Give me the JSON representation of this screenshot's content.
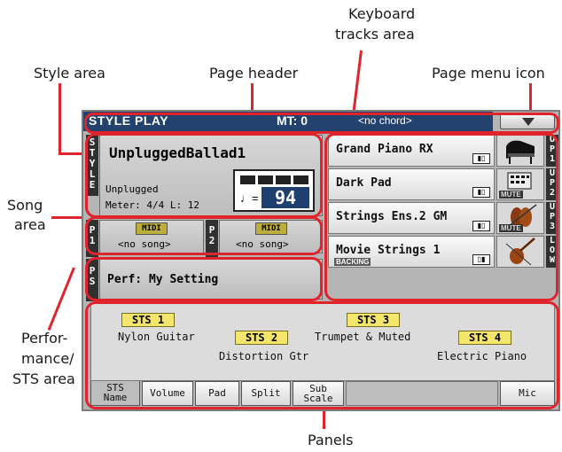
{
  "callouts": {
    "keyboard_tracks_line1": "Keyboard",
    "keyboard_tracks_line2": "tracks area",
    "style_area": "Style area",
    "page_header": "Page header",
    "page_menu_icon": "Page menu icon",
    "song_area_line1": "Song",
    "song_area_line2": "area",
    "perf_line1": "Perfor-",
    "perf_line2": "mance/",
    "perf_line3": "STS area",
    "panels": "Panels"
  },
  "header": {
    "title": "STYLE PLAY",
    "mt": "MT: 0",
    "chord": "<no chord>"
  },
  "style": {
    "side_label": [
      "S",
      "T",
      "Y",
      "L",
      "E"
    ],
    "name": "UnpluggedBallad1",
    "category": "Unplugged",
    "meter": "Meter:  4/4  L:  12",
    "tempo_symbol": "♩=",
    "tempo": "94"
  },
  "songs": [
    {
      "label": [
        "P",
        "1"
      ],
      "badge": "MIDI",
      "name": "<no song>"
    },
    {
      "label": [
        "P",
        "2"
      ],
      "badge": "MIDI",
      "name": "<no song>"
    }
  ],
  "performance": {
    "label": [
      "P",
      "S"
    ],
    "text": "Perf:  My Setting"
  },
  "tracks": [
    {
      "name": "Grand Piano RX",
      "label": "UP1",
      "icon": "piano-icon",
      "muted": false,
      "backing": ""
    },
    {
      "name": "Dark Pad",
      "label": "UP2",
      "icon": "pad-icon",
      "muted": true,
      "mute_text": "MUTE",
      "backing": ""
    },
    {
      "name": "Strings Ens.2 GM",
      "label": "UP3",
      "icon": "strings-icon",
      "muted": true,
      "mute_text": "MUTE",
      "backing": ""
    },
    {
      "name": "Movie Strings 1",
      "label": "LOW",
      "icon": "violin-icon",
      "muted": false,
      "backing": "BACKING"
    }
  ],
  "sts": [
    {
      "label": "STS 1",
      "name": "Nylon Guitar"
    },
    {
      "label": "STS 2",
      "name": "Distortion Gtr"
    },
    {
      "label": "STS 3",
      "name": "Trumpet & Muted"
    },
    {
      "label": "STS 4",
      "name": "Electric Piano"
    }
  ],
  "tabs": [
    {
      "label": "STS",
      "label2": "Name",
      "active": true
    },
    {
      "label": "Volume"
    },
    {
      "label": "Pad"
    },
    {
      "label": "Split"
    },
    {
      "label": "Sub",
      "label2": "Scale"
    },
    {
      "label": "Mic"
    }
  ],
  "colors": {
    "accent_red": "#e0242b",
    "header_blue": "#23426e",
    "sts_yellow": "#f3e66a"
  }
}
